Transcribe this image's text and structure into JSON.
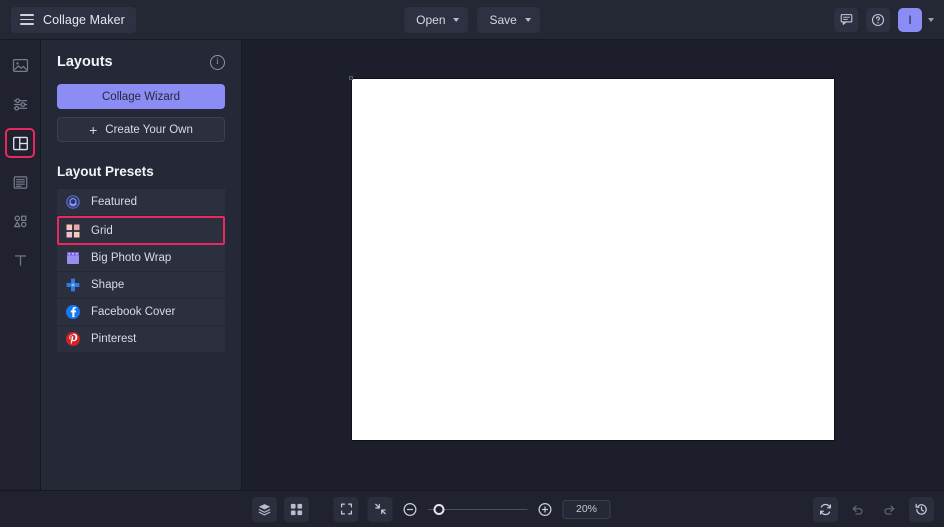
{
  "app": {
    "title": "Collage Maker",
    "accent_purple": "#8c8cf5",
    "highlight_pink": "#e8285f",
    "panel_bg": "#252836",
    "canvas_bg": "#1c1f2b"
  },
  "topbar": {
    "menu_icon": "hamburger-icon",
    "open_label": "Open",
    "save_label": "Save",
    "comment_icon": "comment-icon",
    "help_icon": "help-circle-icon",
    "avatar_initial": "I",
    "avatar_chevron_icon": "chevron-down-icon"
  },
  "rail": {
    "items": [
      {
        "name": "images",
        "icon": "image-icon",
        "selected": false
      },
      {
        "name": "adjust",
        "icon": "sliders-icon",
        "selected": false
      },
      {
        "name": "layouts",
        "icon": "layout-icon",
        "selected": true
      },
      {
        "name": "background",
        "icon": "background-icon",
        "selected": false
      },
      {
        "name": "shapes",
        "icon": "shapes-icon",
        "selected": false
      },
      {
        "name": "text",
        "icon": "text-icon",
        "selected": false
      }
    ]
  },
  "panel": {
    "title": "Layouts",
    "info_icon": "info-icon",
    "wizard_label": "Collage Wizard",
    "create_own_label": "Create Your Own",
    "create_own_icon": "plus-icon",
    "presets_title": "Layout Presets",
    "presets": [
      {
        "label": "Featured",
        "icon": "featured-badge-icon",
        "selected": false
      },
      {
        "label": "Grid",
        "icon": "grid-icon",
        "selected": true
      },
      {
        "label": "Big Photo Wrap",
        "icon": "big-photo-wrap-icon",
        "selected": false
      },
      {
        "label": "Shape",
        "icon": "shape-cross-icon",
        "selected": false
      },
      {
        "label": "Facebook Cover",
        "icon": "facebook-icon",
        "selected": false
      },
      {
        "label": "Pinterest",
        "icon": "pinterest-icon",
        "selected": false
      }
    ]
  },
  "canvas": {
    "sheet_color": "#ffffff"
  },
  "bottombar": {
    "layers_icon": "layers-icon",
    "grid_view_icon": "grid-view-icon",
    "fullscreen_icon": "fullscreen-icon",
    "fit_icon": "fit-to-screen-icon",
    "zoom_out_icon": "zoom-out-icon",
    "zoom_in_icon": "zoom-in-icon",
    "zoom_value": "20%",
    "reset_icon": "reset-icon",
    "undo_icon": "undo-icon",
    "redo_icon": "redo-icon",
    "history_icon": "history-icon"
  }
}
